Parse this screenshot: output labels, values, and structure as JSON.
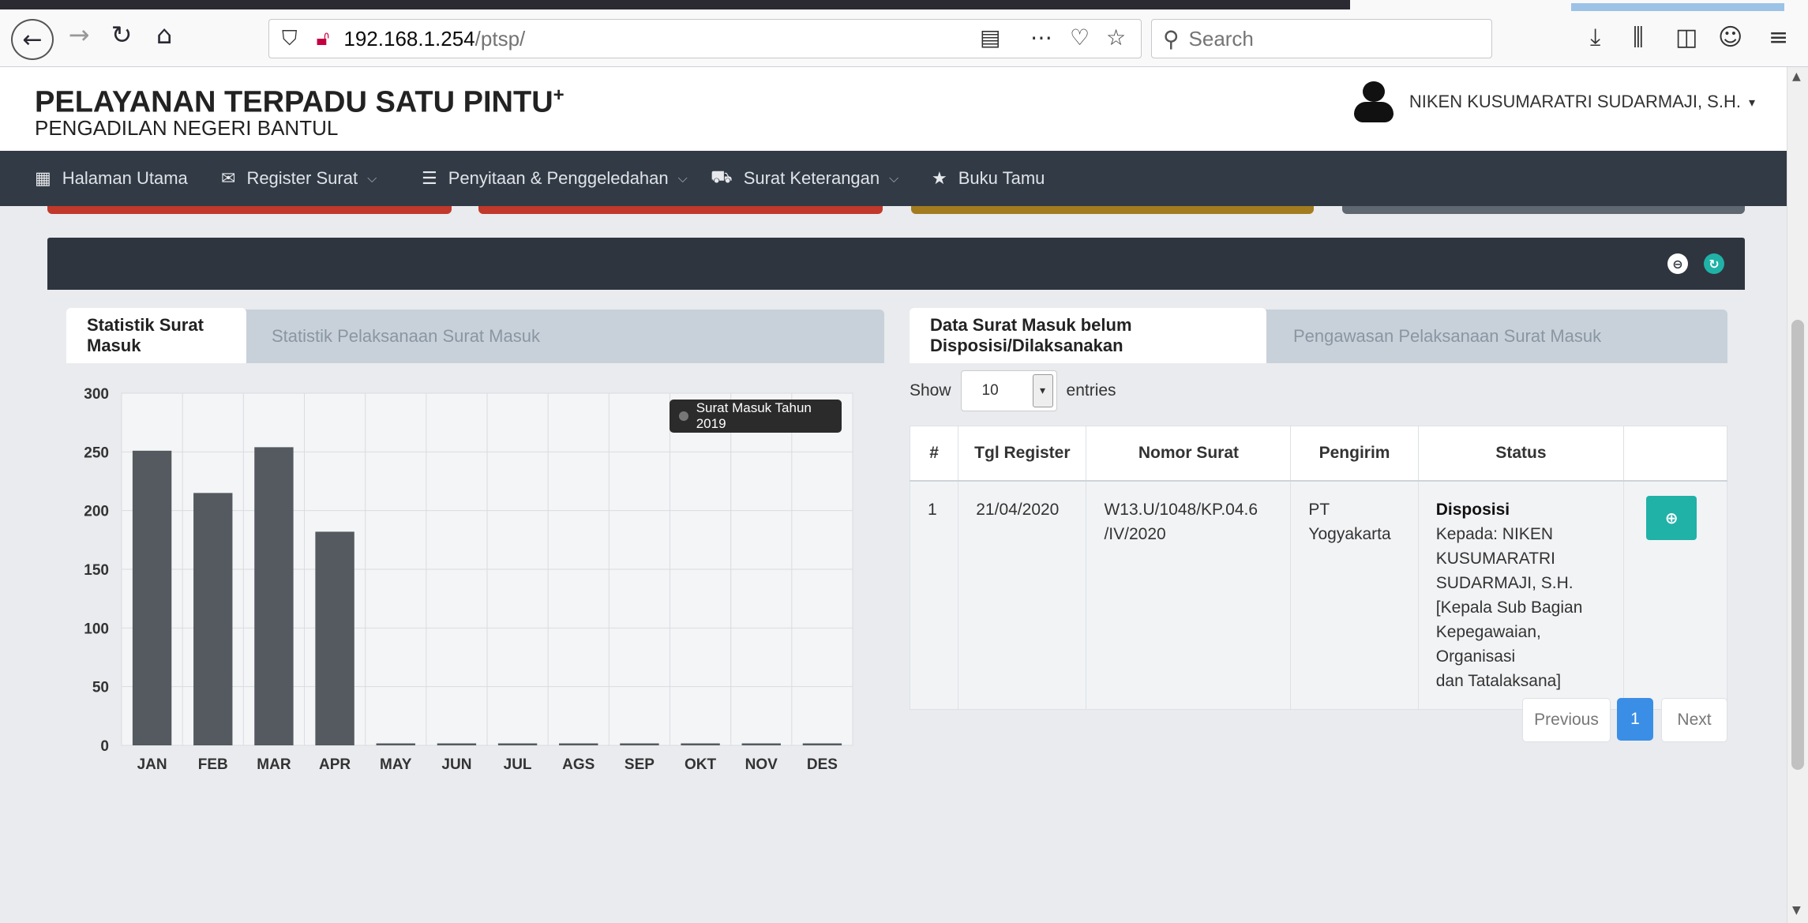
{
  "browser": {
    "url_host": "192.168.1.254",
    "url_path": "/ptsp/",
    "search_placeholder": "Search"
  },
  "header": {
    "title": "PELAYANAN TERPADU SATU PINTU",
    "title_plus": "+",
    "subtitle": "PENGADILAN NEGERI BANTUL",
    "user_name": "NIKEN KUSUMARATRI SUDARMAJI, S.H."
  },
  "nav": {
    "items": [
      {
        "label": "Halaman Utama",
        "icon": "grid-icon",
        "dropdown": false
      },
      {
        "label": "Register Surat",
        "icon": "envelope-icon",
        "dropdown": true
      },
      {
        "label": "Penyitaan & Penggeledahan",
        "icon": "list-icon",
        "dropdown": true
      },
      {
        "label": "Surat Keterangan",
        "icon": "drive-icon",
        "dropdown": true
      },
      {
        "label": "Buku Tamu",
        "icon": "star-icon",
        "dropdown": false
      }
    ]
  },
  "colors": {
    "strip_red": "#c0392b",
    "strip_gold": "#a27c1f",
    "strip_gray": "#5f6771",
    "bar": "#555a60",
    "teal": "#20b2a7",
    "primary": "#3a8ee6"
  },
  "left_panel": {
    "tabs": [
      "Statistik Surat Masuk",
      "Statistik Pelaksanaan Surat Masuk"
    ]
  },
  "chart_data": {
    "type": "bar",
    "categories": [
      "JAN",
      "FEB",
      "MAR",
      "APR",
      "MAY",
      "JUN",
      "JUL",
      "AGS",
      "SEP",
      "OKT",
      "NOV",
      "DES"
    ],
    "series": [
      {
        "name": "Surat Masuk Tahun 2019",
        "values": [
          251,
          215,
          254,
          182,
          0,
          0,
          0,
          0,
          0,
          0,
          0,
          0
        ]
      }
    ],
    "y_ticks": [
      0,
      50,
      100,
      150,
      200,
      250,
      300
    ],
    "ylim": [
      0,
      300
    ],
    "grid": true,
    "legend_position": "top-right"
  },
  "right_panel": {
    "tabs": [
      "Data Surat Masuk belum Disposisi/Dilaksanakan",
      "Pengawasan Pelaksanaan Surat Masuk"
    ],
    "show_label": "Show",
    "entries_label": "entries",
    "page_length": "10",
    "columns": [
      "#",
      "Tgl Register",
      "Nomor Surat",
      "Pengirim",
      "Status",
      ""
    ],
    "rows": [
      {
        "no": "1",
        "tgl": "21/04/2020",
        "nomor_line1": "W13.U/1048/KP.04.6",
        "nomor_line2": "/IV/2020",
        "pengirim": "PT Yogyakarta",
        "status_title": "Disposisi",
        "status_lines": [
          "Kepada: NIKEN",
          "KUSUMARATRI",
          "SUDARMAJI, S.H.",
          "[Kepala Sub Bagian",
          "Kepegawaian, Organisasi",
          "dan Tatalaksana]"
        ]
      }
    ],
    "pagination": {
      "previous": "Previous",
      "current": "1",
      "next": "Next"
    }
  }
}
